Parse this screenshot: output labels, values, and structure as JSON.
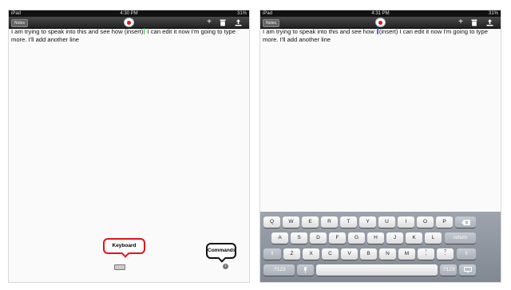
{
  "left": {
    "status": {
      "carrier": "iPad",
      "time": "4:30 PM",
      "battery": "31%"
    },
    "toolbar": {
      "notes_label": "Notes"
    },
    "text_before": "I am trying to speak into this and see how (insert)",
    "text_after": " I can edit it now I'm going to type more. I'll add another line",
    "callout_keyboard": "Keyboard",
    "callout_commands": "Commands"
  },
  "right": {
    "status": {
      "carrier": "iPad",
      "time": "4:31 PM",
      "battery": "31%"
    },
    "toolbar": {
      "notes_label": "Notes"
    },
    "text_before": "I am trying to speak into this and see how ",
    "text_after": "(insert)  I can edit it now I'm going to type more. I'll add another line"
  },
  "toolbar_icons": {
    "add": "plus-icon",
    "delete": "trash-icon",
    "share": "share-icon"
  },
  "keyboard": {
    "row1": [
      "Q",
      "W",
      "E",
      "R",
      "T",
      "Y",
      "U",
      "I",
      "O",
      "P"
    ],
    "row2": [
      "A",
      "S",
      "D",
      "F",
      "G",
      "H",
      "J",
      "K",
      "L"
    ],
    "row3": [
      "Z",
      "X",
      "C",
      "V",
      "B",
      "N",
      "M"
    ],
    "row3_punct": [
      {
        "main": ",",
        "sub": "!"
      },
      {
        "main": ".",
        "sub": "?"
      }
    ],
    "return_label": "return",
    "numbers_label": ".?123"
  },
  "colors": {
    "record": "#e0141e",
    "callout_keyboard": "#e0141e",
    "callout_commands": "#111111"
  }
}
